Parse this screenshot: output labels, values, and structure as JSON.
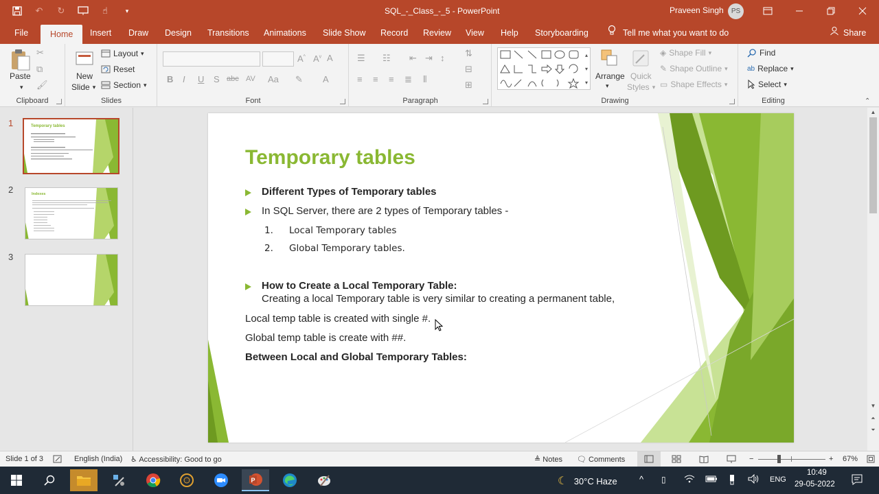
{
  "window": {
    "title": "SQL_-_Class_-_5  -  PowerPoint",
    "user_name": "Praveen Singh",
    "user_initials": "PS"
  },
  "tabs": {
    "file": "File",
    "home": "Home",
    "insert": "Insert",
    "draw": "Draw",
    "design": "Design",
    "transitions": "Transitions",
    "animations": "Animations",
    "slide_show": "Slide Show",
    "record": "Record",
    "review": "Review",
    "view": "View",
    "help": "Help",
    "storyboarding": "Storyboarding"
  },
  "tell_me": "Tell me what you want to do",
  "share": "Share",
  "ribbon": {
    "clipboard": {
      "label": "Clipboard",
      "paste": "Paste"
    },
    "slides": {
      "label": "Slides",
      "new_slide_1": "New",
      "new_slide_2": "Slide",
      "layout": "Layout",
      "reset": "Reset",
      "section": "Section"
    },
    "font": {
      "label": "Font"
    },
    "paragraph": {
      "label": "Paragraph"
    },
    "drawing": {
      "label": "Drawing",
      "arrange": "Arrange",
      "quick_styles_1": "Quick",
      "quick_styles_2": "Styles",
      "shape_fill": "Shape Fill",
      "shape_outline": "Shape Outline",
      "shape_effects": "Shape Effects"
    },
    "editing": {
      "label": "Editing",
      "find": "Find",
      "replace": "Replace",
      "select": "Select"
    }
  },
  "thumbnails": [
    {
      "number": "1",
      "title": "Temporary tables",
      "selected": true
    },
    {
      "number": "2",
      "title": "Indexes",
      "selected": false
    },
    {
      "number": "3",
      "title": "",
      "selected": false
    }
  ],
  "slide": {
    "title": "Temporary tables",
    "bullet1": "Different Types of Temporary tables",
    "bullet2": "In SQL Server, there are 2 types of Temporary tables -",
    "num1": "1.",
    "item1": "Local Temporary tables",
    "num2": "2.",
    "item2": "Global Temporary tables.",
    "bullet3": "How to Create a Local Temporary Table:",
    "bullet3_sub": "Creating a local Temporary table is very similar to creating a permanent table,",
    "line1": "Local temp table is created with single #.",
    "line2": "Global temp table is create with ##.",
    "line3": "Between Local and Global Temporary Tables:"
  },
  "status": {
    "slide_count": "Slide 1 of 3",
    "language": "English (India)",
    "accessibility": "Accessibility: Good to go",
    "notes": "Notes",
    "comments": "Comments",
    "zoom": "67%"
  },
  "taskbar": {
    "weather": "30°C  Haze",
    "lang": "ENG",
    "time": "10:49",
    "date": "29-05-2022"
  },
  "colors": {
    "accent": "#b7472a",
    "slide_green": "#8ab833"
  }
}
